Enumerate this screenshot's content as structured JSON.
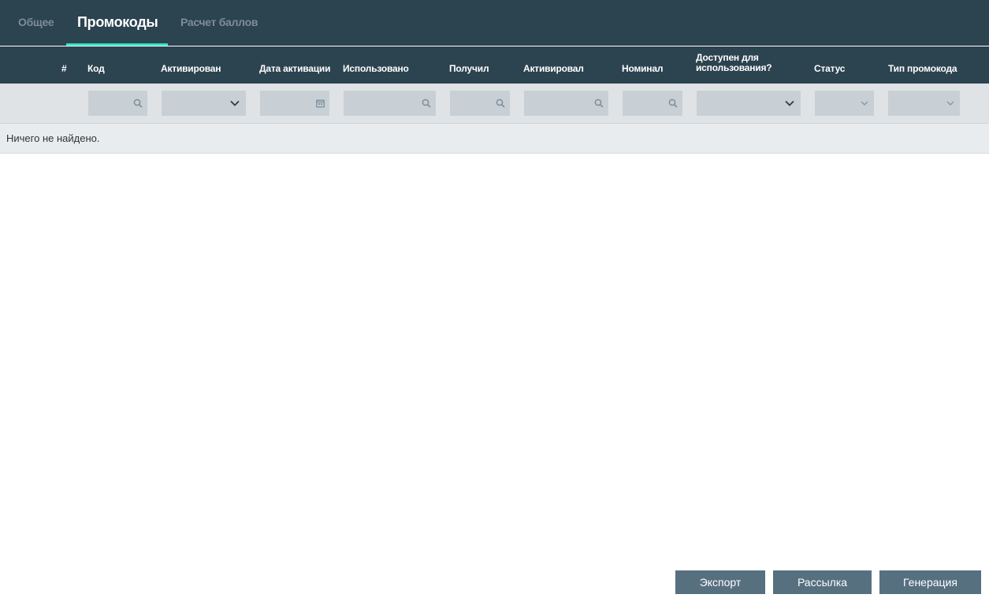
{
  "tabs": [
    {
      "label": "Общее",
      "active": false
    },
    {
      "label": "Промокоды",
      "active": true
    },
    {
      "label": "Расчет баллов",
      "active": false
    }
  ],
  "columns": {
    "num": "#",
    "code": "Код",
    "activated": "Активирован",
    "activation_date": "Дата активации",
    "used": "Использовано",
    "received": "Получил",
    "activated_by": "Активировал",
    "nominal": "Номинал",
    "available": "Доступен для использования?",
    "status": "Статус",
    "promo_type": "Тип промокода"
  },
  "filters": {
    "code": {
      "type": "search",
      "icon": "search-icon"
    },
    "activated": {
      "type": "select",
      "icon": "chevron-down-icon"
    },
    "activation_date": {
      "type": "date",
      "icon": "calendar-icon"
    },
    "used": {
      "type": "search",
      "icon": "search-icon"
    },
    "received": {
      "type": "search",
      "icon": "search-icon"
    },
    "activated_by": {
      "type": "search",
      "icon": "search-icon"
    },
    "nominal": {
      "type": "search",
      "icon": "search-icon"
    },
    "available": {
      "type": "select",
      "icon": "chevron-down-icon"
    },
    "status": {
      "type": "select",
      "icon": "chevron-down-icon"
    },
    "promo_type": {
      "type": "select",
      "icon": "chevron-down-icon"
    }
  },
  "empty_message": "Ничего не найдено.",
  "buttons": {
    "export": "Экспорт",
    "mailing": "Рассылка",
    "generate": "Генерация"
  },
  "colors": {
    "header_bg": "#2c4350",
    "accent": "#2ee6c0",
    "filter_bg": "#dfe3e6",
    "filter_box": "#c8d0d5",
    "button_bg": "#577080"
  }
}
